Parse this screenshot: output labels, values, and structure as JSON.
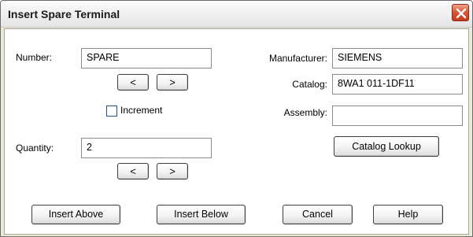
{
  "window": {
    "title": "Insert Spare Terminal",
    "close_icon": "close-x-icon"
  },
  "number": {
    "label": "Number:",
    "value": "SPARE",
    "prev_label": "<",
    "next_label": ">"
  },
  "increment": {
    "label": "Increment",
    "checked": false
  },
  "quantity": {
    "label": "Quantity:",
    "value": "2",
    "prev_label": "<",
    "next_label": ">"
  },
  "manufacturer": {
    "label": "Manufacturer:",
    "value": "SIEMENS"
  },
  "catalog": {
    "label": "Catalog:",
    "value": "8WA1 011-1DF11"
  },
  "assembly": {
    "label": "Assembly:",
    "value": ""
  },
  "catalog_lookup_label": "Catalog Lookup",
  "footer": {
    "insert_above_label": "Insert Above",
    "insert_below_label": "Insert Below",
    "cancel_label": "Cancel",
    "help_label": "Help"
  },
  "colors": {
    "close_button": "#d9593b",
    "dialog_face": "#ffffff",
    "title_bar": "#f1f1f1"
  }
}
